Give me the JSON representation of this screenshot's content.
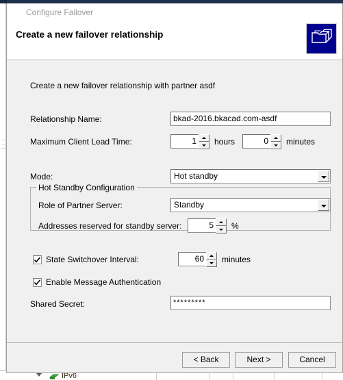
{
  "window": {
    "titlebar_color": "#1e3250",
    "subtitle": "Configure Failover",
    "title": "Create a new failover relationship",
    "icon_name": "stacked-folders-icon"
  },
  "body": {
    "intro": "Create a new failover relationship with partner asdf",
    "relationship_name": {
      "label": "Relationship Name:",
      "value": "bkad-2016.bkacad.com-asdf"
    },
    "max_client_lead_time": {
      "label": "Maximum Client Lead Time:",
      "hours_value": "1",
      "hours_unit": "hours",
      "minutes_value": "0",
      "minutes_unit": "minutes"
    },
    "mode": {
      "label": "Mode:",
      "value": "Hot standby"
    },
    "hot_standby_group": {
      "title": "Hot Standby Configuration",
      "role_of_partner": {
        "label": "Role of Partner Server:",
        "value": "Standby"
      },
      "addresses_reserved": {
        "label": "Addresses reserved for standby server:",
        "value": "5",
        "unit": "%"
      }
    },
    "state_switchover": {
      "label": "State Switchover Interval:",
      "checked": true,
      "value": "60",
      "unit": "minutes"
    },
    "message_auth": {
      "label": "Enable Message Authentication",
      "checked": true
    },
    "shared_secret": {
      "label": "Shared Secret:",
      "value": "*********"
    }
  },
  "footer": {
    "back": "< Back",
    "next": "Next >",
    "cancel": "Cancel"
  },
  "background": {
    "tree_item_label": "IPv6"
  }
}
